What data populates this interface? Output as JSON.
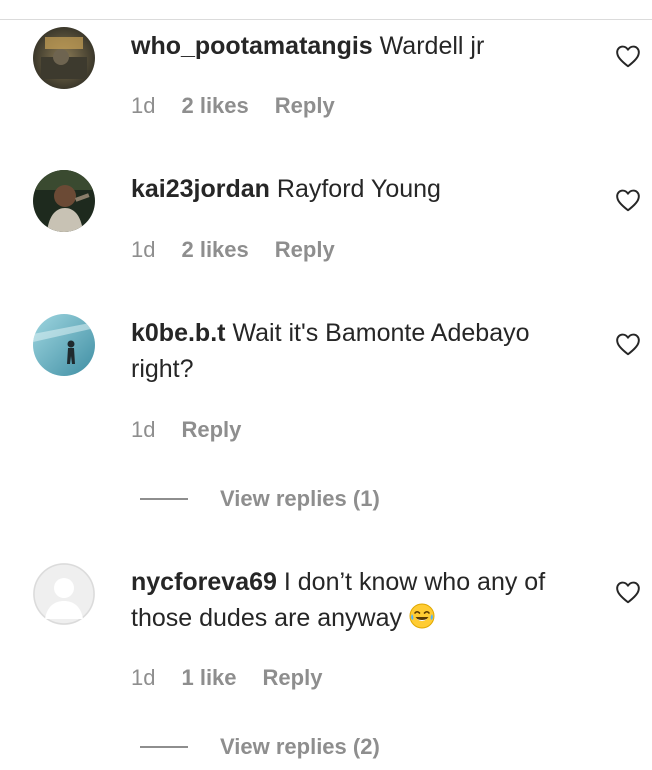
{
  "comments": [
    {
      "username": "who_pootamatangis",
      "text": "Wardell jr",
      "time": "1d",
      "likes": "2 likes",
      "reply": "Reply"
    },
    {
      "username": "kai23jordan",
      "text": "Rayford Young",
      "time": "1d",
      "likes": "2 likes",
      "reply": "Reply"
    },
    {
      "username": "k0be.b.t",
      "text": "Wait it's Bamonte Adebayo right?",
      "time": "1d",
      "reply": "Reply",
      "view_replies": "View replies (1)"
    },
    {
      "username": "nycforeva69",
      "text": "I don’t know who any of those dudes are anyway",
      "time": "1d",
      "likes": "1 like",
      "reply": "Reply",
      "view_replies": "View replies (2)"
    }
  ],
  "icons": {
    "like": "heart-outline-icon",
    "emoji": "face-with-tears-of-joy-icon"
  },
  "colors": {
    "text": "#262626",
    "muted": "#8e8e8e",
    "divider": "#dbdbdb"
  }
}
